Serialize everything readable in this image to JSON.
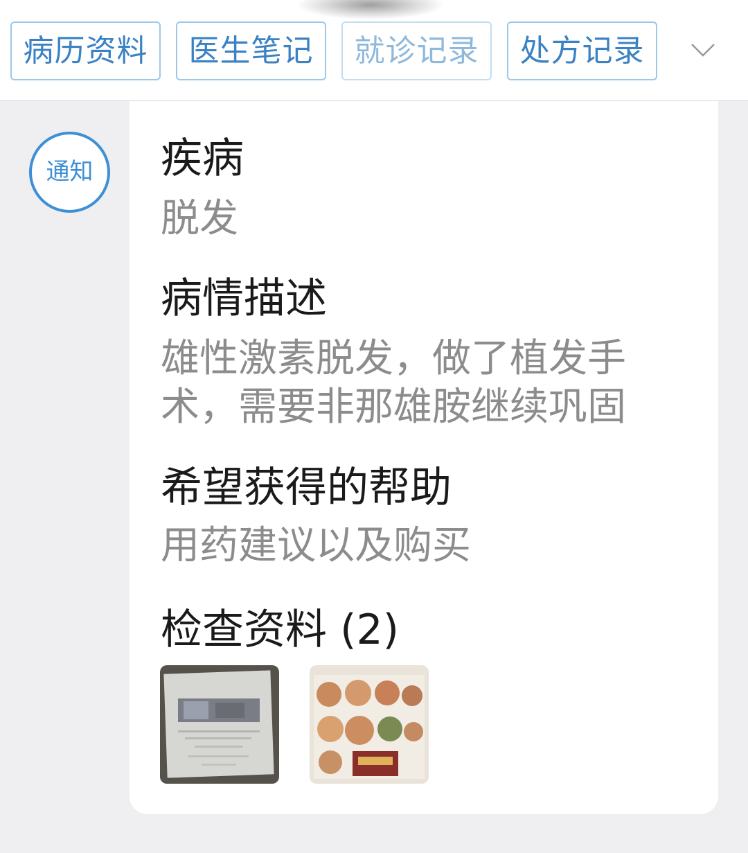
{
  "tabs": [
    "病历资料",
    "医生笔记",
    "就诊记录",
    "处方记录"
  ],
  "notice_badge": "通知",
  "sections": {
    "disease": {
      "heading": "疾病",
      "value": "脱发"
    },
    "description": {
      "heading": "病情描述",
      "line1": "雄性激素脱发，做了植发手",
      "line2": "术，需要非那雄胺继续巩固"
    },
    "help": {
      "heading": "希望获得的帮助",
      "value": "用药建议以及购买"
    },
    "materials": {
      "heading": "检查资料",
      "count": "(2)"
    }
  },
  "colors": {
    "accent": "#3d8fd6",
    "tab_border": "#9dc7e6",
    "heading": "#1a1a1a",
    "value": "#8c8c8c",
    "background": "#efeff1"
  },
  "icons": [
    "chevron-down-icon"
  ]
}
